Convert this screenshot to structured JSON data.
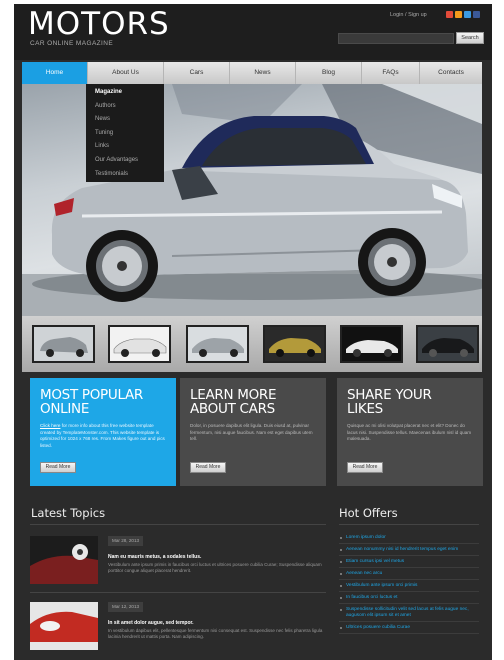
{
  "header": {
    "logo": "MOTORS",
    "tagline": "CAR ONLINE MAGAZINE",
    "login": "Login",
    "register": "Sign up",
    "separator": "/",
    "search_button": "Search",
    "social_colors": [
      "#e24b3a",
      "#f49a1c",
      "#3b9ae1",
      "#3b5998"
    ]
  },
  "nav": {
    "items": [
      "Home",
      "About Us",
      "Cars",
      "News",
      "Blog",
      "FAQs",
      "Contacts"
    ],
    "active": "Home"
  },
  "dropdown": {
    "items": [
      "Magazine",
      "Authors",
      "News",
      "Tuning",
      "Links",
      "Our Advantages",
      "Testimonials"
    ]
  },
  "boxes": [
    {
      "title_line1": "MOST POPULAR",
      "title_line2": "ONLINE",
      "link": "Click here",
      "text": "for more info about this free website template created by TemplateMonster.com. This website template is optimized for 1024 x 768 res. From Makes figure out and pics listed.",
      "button": "Read More"
    },
    {
      "title_line1": "LEARN MORE",
      "title_line2": "ABOUT CARS",
      "text": "Dolor, in posuere dapibus elit ligula. Duis eiusd at, pulvinar fermentum, nisi augue faucibus. Nam est eget dapibus utem tell.",
      "button": "Read More"
    },
    {
      "title_line1": "SHARE YOUR",
      "title_line2": "LIKES",
      "text": "Quisque ac mi olisi volutpat placerat nec et elit? Donec do lacus nisi. Suspendisse tellus. Maecenas ibulum nisl id quam malesuada.",
      "button": "Read More"
    }
  ],
  "latest_topics": {
    "heading": "Latest Topics",
    "items": [
      {
        "date": "Mar 28, 2013",
        "title": "Nam eu mauris metus, a sodales tellus.",
        "excerpt": "Vestibulum ante ipsum primis in faucibus orci luctus et ultrices posuere cubilia Curae; Suspendisse aliquam porttitor congue aliquet placerat hendrerit."
      },
      {
        "date": "Mar 12, 2013",
        "title": "In sit amet dolor augue, sed tempor.",
        "excerpt": "In vestibulum dapibus elit, pellentesque fermentum nisi consequat est. Suspendisse nec felis pharetra ligula lacinia hendrerit ut mattis porta. Nam adipiscing."
      }
    ]
  },
  "hot_offers": {
    "heading": "Hot Offers",
    "items": [
      "Lorem ipsum dolor",
      "Aenean nonummy nisi id hendrerit tempus eget enim",
      "Etiam cursus ipsi vel metus",
      "Aenean nec arcu",
      "Vestibulum ante ipsum orci primis",
      "In faucibus orci luctus et",
      "Suspendisse sollicitudin velit sed lacus at felis augue nec, augusom elit ipsum sit et amet",
      "Ultrices posuere cubilia Curae"
    ]
  }
}
